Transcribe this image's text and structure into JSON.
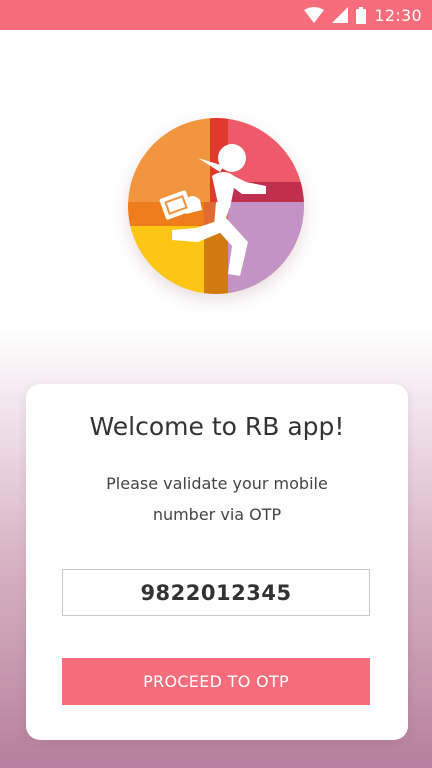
{
  "status_bar": {
    "time": "12:30",
    "icons": [
      "wifi-icon",
      "signal-icon",
      "battery-icon"
    ]
  },
  "logo": {
    "icon": "running-businessman-icon"
  },
  "card": {
    "title": "Welcome to RB app!",
    "subtitle": "Please validate your mobile number via OTP",
    "phone_value": "9822012345",
    "proceed_label": "PROCEED TO OTP"
  },
  "colors": {
    "accent": "#f76d7b",
    "background_gradient_end": "#b77f9d",
    "logo_orange": "#f2953f",
    "logo_red": "#ef5a6a",
    "logo_yellow": "#fdc514",
    "logo_lilac": "#c493c6"
  }
}
